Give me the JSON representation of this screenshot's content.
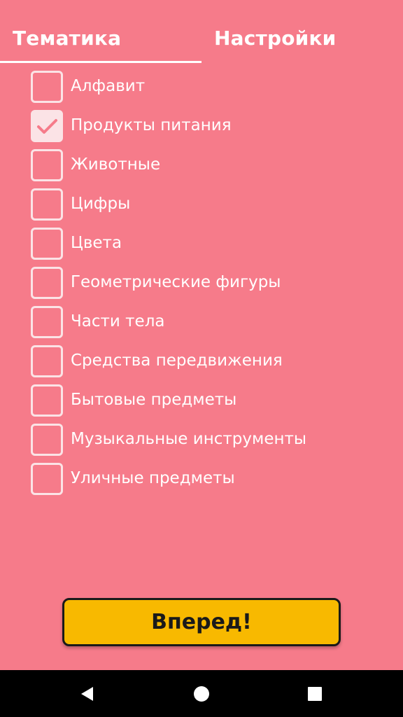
{
  "tabs": {
    "topics": "Тематика",
    "settings": "Настройки",
    "active": "topics"
  },
  "topics": [
    {
      "label": "Алфавит",
      "checked": false
    },
    {
      "label": "Продукты питания",
      "checked": true
    },
    {
      "label": "Животные",
      "checked": false
    },
    {
      "label": "Цифры",
      "checked": false
    },
    {
      "label": "Цвета",
      "checked": false
    },
    {
      "label": "Геометрические фигуры",
      "checked": false
    },
    {
      "label": "Части тела",
      "checked": false
    },
    {
      "label": "Средства передвижения",
      "checked": false
    },
    {
      "label": "Бытовые предметы",
      "checked": false
    },
    {
      "label": "Музыкальные инструменты",
      "checked": false
    },
    {
      "label": "Уличные предметы",
      "checked": false
    }
  ],
  "go_button": {
    "label": "Вперед!"
  },
  "nav": {
    "back_icon": "triangle-back-icon",
    "home_icon": "circle-home-icon",
    "recent_icon": "square-recent-icon"
  },
  "colors": {
    "background": "#f67b8a",
    "checkbox": "#fbe3e6",
    "checkmark": "#f67b8a",
    "button": "#f8b900",
    "navbar": "#000000"
  }
}
